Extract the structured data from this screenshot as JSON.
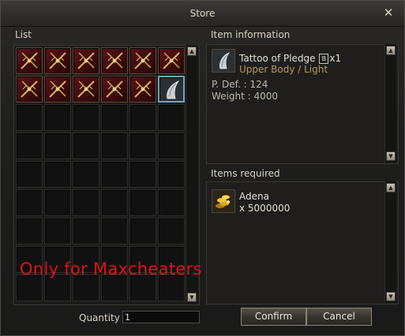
{
  "window": {
    "title": "Store",
    "close_glyph": "✕"
  },
  "list": {
    "label": "List"
  },
  "grid": {
    "rows": [
      [
        "weapon",
        "weapon",
        "weapon",
        "weapon",
        "weapon",
        "weapon"
      ],
      [
        "weapon",
        "weapon",
        "weapon",
        "weapon",
        "weapon",
        "tattoo"
      ],
      [
        "empty",
        "empty",
        "empty",
        "empty",
        "empty",
        "empty"
      ],
      [
        "empty",
        "empty",
        "empty",
        "empty",
        "empty",
        "empty"
      ],
      [
        "empty",
        "empty",
        "empty",
        "empty",
        "empty",
        "empty"
      ],
      [
        "empty",
        "empty",
        "empty",
        "empty",
        "empty",
        "empty"
      ],
      [
        "empty",
        "empty",
        "empty",
        "empty",
        "empty",
        "empty"
      ],
      [
        "empty",
        "empty",
        "empty",
        "empty",
        "empty",
        "empty"
      ],
      [
        "empty",
        "empty",
        "empty",
        "empty",
        "empty",
        "empty"
      ]
    ],
    "selected_slot": "tattoo"
  },
  "item_info": {
    "label": "Item information",
    "name": "Tattoo of Pledge",
    "bless_mark": "B",
    "count": "x1",
    "slot": "Upper Body / Light",
    "stats": [
      "P. Def. : 124",
      "Weight : 4000"
    ]
  },
  "items_required": {
    "label": "Items required",
    "name": "Adena",
    "amount": "x 5000000"
  },
  "watermark": {
    "text": "Only for Maxcheaters"
  },
  "quantity": {
    "label": "Quantity",
    "value": "1"
  },
  "buttons": {
    "confirm": "Confirm",
    "cancel": "Cancel"
  },
  "icons": {
    "scroll_up": "▲",
    "scroll_down": "▼"
  },
  "colors": {
    "accent_gold": "#b59a5c",
    "selection_border": "#6fa5b5",
    "watermark_red": "#e0101c"
  }
}
